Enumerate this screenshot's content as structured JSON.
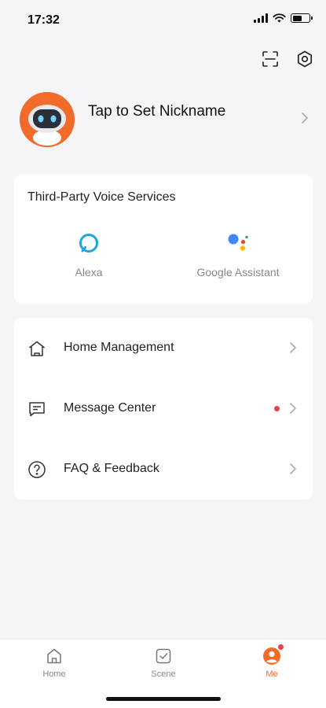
{
  "status_bar": {
    "time": "17:32",
    "battery_level": 0.55
  },
  "top_actions": {
    "scan_icon": "scan-icon",
    "settings_icon": "settings-icon"
  },
  "profile": {
    "nickname": "Tap to Set Nickname",
    "avatar_icon": "robot-avatar"
  },
  "voice_services": {
    "title": "Third-Party Voice Services",
    "items": [
      {
        "label": "Alexa",
        "icon": "alexa-icon"
      },
      {
        "label": "Google Assistant",
        "icon": "google-assistant-icon"
      }
    ]
  },
  "menu": {
    "items": [
      {
        "label": "Home Management",
        "icon": "house-icon"
      },
      {
        "label": "Message Center",
        "icon": "message-icon",
        "has_notification": true
      },
      {
        "label": "FAQ & Feedback",
        "icon": "help-icon"
      }
    ]
  },
  "tab_bar": {
    "tabs": [
      {
        "label": "Home",
        "icon": "home-icon",
        "active": false
      },
      {
        "label": "Scene",
        "icon": "scene-icon",
        "active": false
      },
      {
        "label": "Me",
        "icon": "me-icon",
        "active": true,
        "has_notification": true
      }
    ]
  },
  "colors": {
    "accent": "#f26b2a",
    "notification": "#e8414b",
    "background": "#f5f5f7",
    "card": "#ffffff",
    "alexa": "#1ba8d8"
  }
}
